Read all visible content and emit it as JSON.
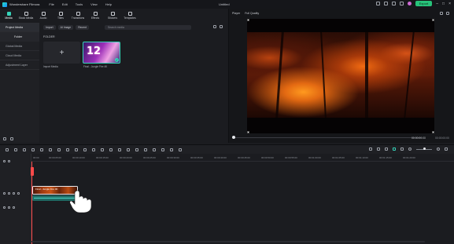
{
  "titlebar": {
    "app_name": "Wondershare Filmora",
    "menu": [
      "File",
      "Edit",
      "Tools",
      "View",
      "Help"
    ],
    "document_title": "Untitled",
    "export_label": "Export"
  },
  "toolbar": {
    "tools": [
      {
        "label": "Media",
        "icon": "media-icon",
        "active": true
      },
      {
        "label": "Stock Media",
        "icon": "stock-media-icon"
      },
      {
        "label": "Audio",
        "icon": "audio-icon"
      },
      {
        "label": "Titles",
        "icon": "titles-icon"
      },
      {
        "label": "Transitions",
        "icon": "transitions-icon"
      },
      {
        "label": "Effects",
        "icon": "effects-icon"
      },
      {
        "label": "Stickers",
        "icon": "stickers-icon"
      },
      {
        "label": "Templates",
        "icon": "templates-icon"
      }
    ]
  },
  "sidebar": {
    "items": [
      {
        "label": "Project Media",
        "active": true
      },
      {
        "label": "Folder",
        "sub": true
      },
      {
        "label": "Global Media"
      },
      {
        "label": "Cloud Media"
      },
      {
        "label": "Adjustment Layer"
      }
    ]
  },
  "media": {
    "import_label": "Import",
    "ai_image_label": "AI Image",
    "recent_label": "Recent",
    "search_placeholder": "Search media",
    "folder_label": "FOLDER",
    "import_media_label": "Import Media",
    "clip_label": "Final - Jungle Fire 4K",
    "clip_thumbnail_text": "12"
  },
  "player": {
    "player_label": "Player",
    "quality_label": "Full Quality",
    "timecode_current": "00:00:00:00",
    "timecode_total": "00:00:00:00"
  },
  "timeline": {
    "ticks": [
      "00:00",
      "00:00:05:00",
      "00:00:10:00",
      "00:00:15:00",
      "00:00:20:00",
      "00:00:25:00",
      "00:00:30:00",
      "00:00:35:00",
      "00:00:40:00",
      "00:00:45:00",
      "00:00:50:00",
      "00:00:55:00",
      "00:01:00:00",
      "00:01:05:00",
      "00:01:10:00",
      "00:01:15:00",
      "00:01:20:00"
    ],
    "video_clip_label": "Final - Jungle Fire 4K"
  }
}
